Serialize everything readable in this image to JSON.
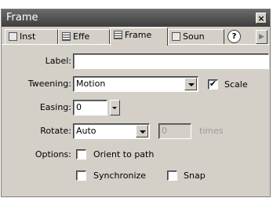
{
  "panel": {
    "title": "Frame"
  },
  "tabs": [
    {
      "label": "Inst",
      "icon": "instance-icon"
    },
    {
      "label": "Effe",
      "icon": "effect-icon"
    },
    {
      "label": "Frame",
      "icon": "frame-icon",
      "active": true
    },
    {
      "label": "Soun",
      "icon": "sound-icon"
    }
  ],
  "help_label": "?",
  "form": {
    "label": {
      "caption": "Label:",
      "value": ""
    },
    "tweening": {
      "caption": "Tweening:",
      "value": "Motion"
    },
    "scale": {
      "caption": "Scale",
      "checked": true
    },
    "easing": {
      "caption": "Easing:",
      "value": "0"
    },
    "rotate": {
      "caption": "Rotate:",
      "value": "Auto",
      "times_value": "0",
      "times_label": "times"
    },
    "options": {
      "caption": "Options:",
      "orient_to_path": {
        "caption": "Orient to path",
        "checked": false
      },
      "synchronize": {
        "caption": "Synchronize",
        "checked": false
      },
      "snap": {
        "caption": "Snap",
        "checked": false
      }
    }
  },
  "check_mark": "✔"
}
